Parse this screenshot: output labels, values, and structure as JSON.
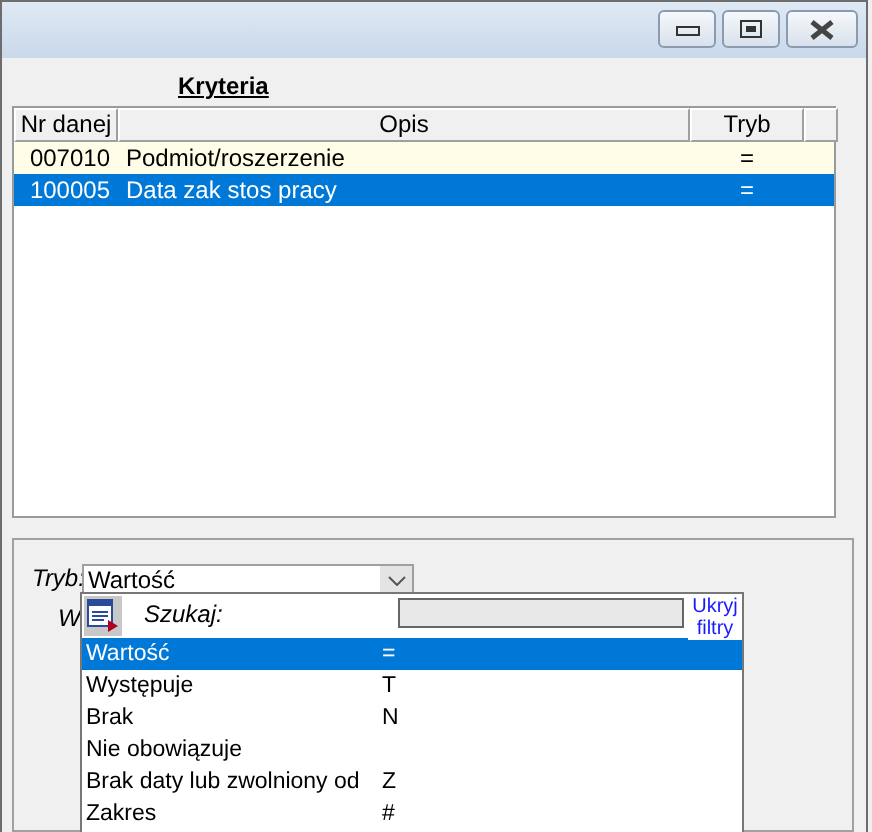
{
  "window": {
    "controls": [
      {
        "kind": "minimize"
      },
      {
        "kind": "restore"
      },
      {
        "kind": "close"
      }
    ]
  },
  "criteria": {
    "title": "Kryteria",
    "columns": [
      "Nr danej",
      "Opis",
      "Tryb"
    ],
    "rows": [
      {
        "nr": "007010",
        "opis": "Podmiot/roszerzenie",
        "tryb": "=",
        "selected": false
      },
      {
        "nr": "100005",
        "opis": "Data zak stos pracy",
        "tryb": "=",
        "selected": true
      }
    ]
  },
  "form": {
    "tryb_label": "Tryb:",
    "tryb_value": "Wartość",
    "hidden_label": "W"
  },
  "dropdown": {
    "search_label": "Szukaj:",
    "hide_filters": "Ukryj filtry",
    "items": [
      {
        "label": "Wartość",
        "code": "=",
        "selected": true
      },
      {
        "label": "Występuje",
        "code": "T",
        "selected": false
      },
      {
        "label": "Brak",
        "code": "N",
        "selected": false
      },
      {
        "label": "Nie obowiązuje",
        "selected": false
      },
      {
        "label": "Brak daty lub zwolniony od",
        "code": "Z",
        "selected": false
      },
      {
        "label": "Zakres",
        "code": "#",
        "selected": false
      }
    ]
  }
}
